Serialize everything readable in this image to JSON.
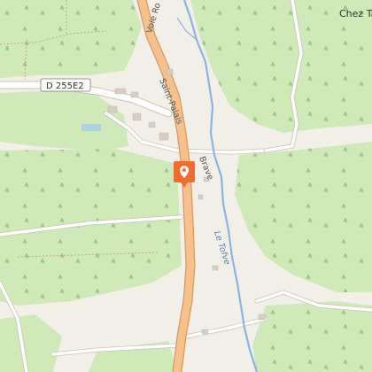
{
  "map": {
    "labels": {
      "place_top_right": "Chez Ta",
      "road_vertical": "Voie Ro",
      "road_shield": "D 255E2",
      "street_saint_palais": "Saint-Palais",
      "hamlet_brave": "Brave",
      "river": "Le Tofve"
    },
    "marker": {
      "icon": "map-pin-icon",
      "color": "#f26b2f"
    },
    "colors": {
      "background": "#f2efe9",
      "forest": "#cfe9b9",
      "major_road": "#f6c18c",
      "road_casing": "#d59a5e",
      "minor_road": "#ffffff",
      "water": "#8ab4e0"
    }
  }
}
